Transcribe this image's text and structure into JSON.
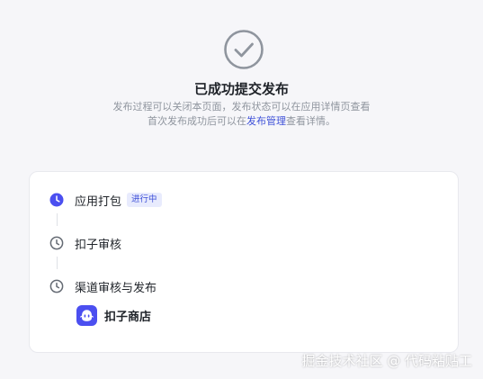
{
  "result": {
    "title": "已成功提交发布",
    "desc_line1": "发布过程可以关闭本页面，发布状态可以在应用详情页查看",
    "desc_line2_pre": "首次发布成功后可以在",
    "desc_link": "发布管理",
    "desc_line2_post": "查看详情。"
  },
  "steps": [
    {
      "label": "应用打包",
      "badge": "进行中",
      "status": "active"
    },
    {
      "label": "扣子审核",
      "status": "pending"
    },
    {
      "label": "渠道审核与发布",
      "status": "pending"
    }
  ],
  "store": {
    "name": "扣子商店"
  },
  "watermark": "掘金技术社区 @ 代码粘贴工",
  "colors": {
    "accent": "#3f51d8",
    "active_step": "#4b4ff0",
    "pending_step": "#646a73",
    "success_icon": "#8f959e"
  },
  "icons": {
    "success": "check-circle-icon",
    "active": "clock-filled-icon",
    "pending": "clock-outline-icon",
    "store": "coze-logo-icon"
  }
}
